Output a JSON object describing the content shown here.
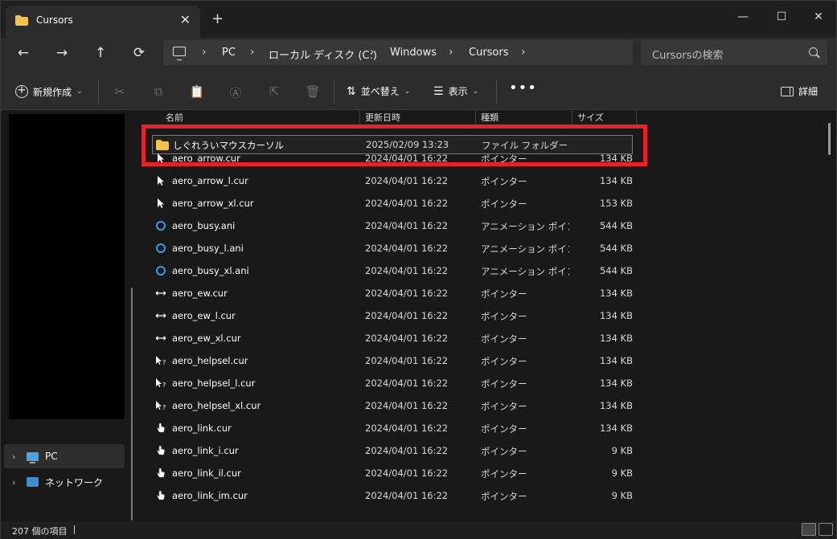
{
  "titlebar": {
    "tab_title": "Cursors",
    "tab_close": "✕",
    "new_tab": "+",
    "minimize": "—",
    "maximize": "☐",
    "close": "✕"
  },
  "nav": {
    "back": "←",
    "forward": "→",
    "up": "↑",
    "refresh": "⟳",
    "breadcrumbs": [
      "PC",
      "ローカル ディスク (C:)",
      "Windows",
      "Cursors"
    ],
    "search_placeholder": "Cursorsの検索"
  },
  "commandbar": {
    "new_label": "新規作成",
    "sort_label": "並べ替え",
    "view_label": "表示",
    "more": "•••",
    "details_label": "詳細"
  },
  "sidebar": {
    "items": [
      {
        "label": "PC",
        "icon": "pc-icon"
      },
      {
        "label": "ネットワーク",
        "icon": "network-icon"
      }
    ]
  },
  "columns": {
    "name": "名前",
    "date": "更新日時",
    "type": "種類",
    "size": "サイズ"
  },
  "files": [
    {
      "name": "しぐれういマウスカーソル",
      "date": "2025/02/09 13:23",
      "type": "ファイル フォルダー",
      "size": "",
      "icon": "folder-icon"
    },
    {
      "name": "aero_arrow.cur",
      "date": "2024/04/01 16:22",
      "type": "ポインター",
      "size": "134 KB",
      "icon": "arrow-cursor-icon"
    },
    {
      "name": "aero_arrow_l.cur",
      "date": "2024/04/01 16:22",
      "type": "ポインター",
      "size": "134 KB",
      "icon": "arrow-cursor-icon"
    },
    {
      "name": "aero_arrow_xl.cur",
      "date": "2024/04/01 16:22",
      "type": "ポインター",
      "size": "153 KB",
      "icon": "arrow-cursor-icon"
    },
    {
      "name": "aero_busy.ani",
      "date": "2024/04/01 16:22",
      "type": "アニメーション ポイン...",
      "size": "544 KB",
      "icon": "busy-cursor-icon"
    },
    {
      "name": "aero_busy_l.ani",
      "date": "2024/04/01 16:22",
      "type": "アニメーション ポイン...",
      "size": "544 KB",
      "icon": "busy-cursor-icon"
    },
    {
      "name": "aero_busy_xl.ani",
      "date": "2024/04/01 16:22",
      "type": "アニメーション ポイン...",
      "size": "544 KB",
      "icon": "busy-cursor-icon"
    },
    {
      "name": "aero_ew.cur",
      "date": "2024/04/01 16:22",
      "type": "ポインター",
      "size": "134 KB",
      "icon": "resize-ew-icon"
    },
    {
      "name": "aero_ew_l.cur",
      "date": "2024/04/01 16:22",
      "type": "ポインター",
      "size": "134 KB",
      "icon": "resize-ew-icon"
    },
    {
      "name": "aero_ew_xl.cur",
      "date": "2024/04/01 16:22",
      "type": "ポインター",
      "size": "134 KB",
      "icon": "resize-ew-icon"
    },
    {
      "name": "aero_helpsel.cur",
      "date": "2024/04/01 16:22",
      "type": "ポインター",
      "size": "134 KB",
      "icon": "help-cursor-icon"
    },
    {
      "name": "aero_helpsel_l.cur",
      "date": "2024/04/01 16:22",
      "type": "ポインター",
      "size": "134 KB",
      "icon": "help-cursor-icon"
    },
    {
      "name": "aero_helpsel_xl.cur",
      "date": "2024/04/01 16:22",
      "type": "ポインター",
      "size": "134 KB",
      "icon": "help-cursor-icon"
    },
    {
      "name": "aero_link.cur",
      "date": "2024/04/01 16:22",
      "type": "ポインター",
      "size": "134 KB",
      "icon": "hand-cursor-icon"
    },
    {
      "name": "aero_link_i.cur",
      "date": "2024/04/01 16:22",
      "type": "ポインター",
      "size": "9 KB",
      "icon": "hand-cursor-icon"
    },
    {
      "name": "aero_link_il.cur",
      "date": "2024/04/01 16:22",
      "type": "ポインター",
      "size": "9 KB",
      "icon": "hand-cursor-icon"
    },
    {
      "name": "aero_link_im.cur",
      "date": "2024/04/01 16:22",
      "type": "ポインター",
      "size": "9 KB",
      "icon": "hand-cursor-icon"
    }
  ],
  "status": {
    "item_count": "207 個の項目"
  },
  "colors": {
    "highlight_box": "#e8212a",
    "folder": "#f2c14e",
    "busy_ring": "#3a9be8"
  }
}
